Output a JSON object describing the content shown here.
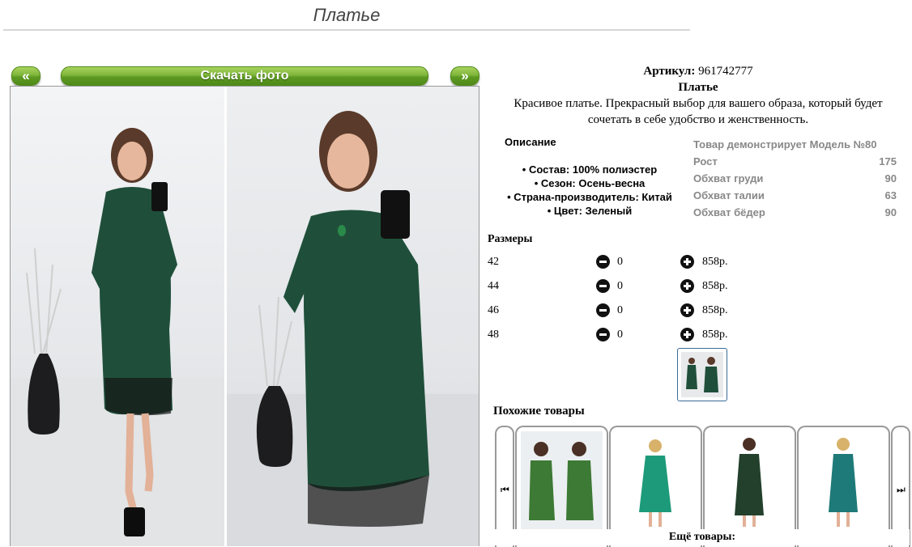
{
  "page": {
    "title": "Платье"
  },
  "photo_nav": {
    "prev_label": "«",
    "download_label": "Скачать фото",
    "next_label": "»"
  },
  "product": {
    "article_label": "Артикул:",
    "article_value": "961742777",
    "name": "Платье",
    "description": "Красивое платье. Прекрасный выбор для вашего образа, который будет сочетать в себе удобство и женственность."
  },
  "details": {
    "title": "Описание",
    "items": [
      "• Состав: 100% полиэстер",
      "• Сезон: Осень-весна",
      "• Страна-производитель: Китай",
      "• Цвет: Зеленый"
    ]
  },
  "model": {
    "title": "Товар демонстрирует Модель №80",
    "rows": [
      {
        "label": "Рост",
        "value": "175"
      },
      {
        "label": "Обхват груди",
        "value": "90"
      },
      {
        "label": "Обхват талии",
        "value": "63"
      },
      {
        "label": "Обхват бёдер",
        "value": "90"
      }
    ]
  },
  "sizes": {
    "title": "Размеры",
    "rows": [
      {
        "size": "42",
        "qty": "0",
        "price": "858р."
      },
      {
        "size": "44",
        "qty": "0",
        "price": "858р."
      },
      {
        "size": "46",
        "qty": "0",
        "price": "858р."
      },
      {
        "size": "48",
        "qty": "0",
        "price": "858р."
      }
    ]
  },
  "similar": {
    "title": "Похожие товары",
    "prev_icon": "skip-back-icon",
    "next_icon": "skip-forward-icon"
  },
  "more": {
    "label": "Ещё товары:"
  },
  "colors": {
    "dress_green": "#1f4f3a",
    "button_green": "#6aa62c"
  }
}
